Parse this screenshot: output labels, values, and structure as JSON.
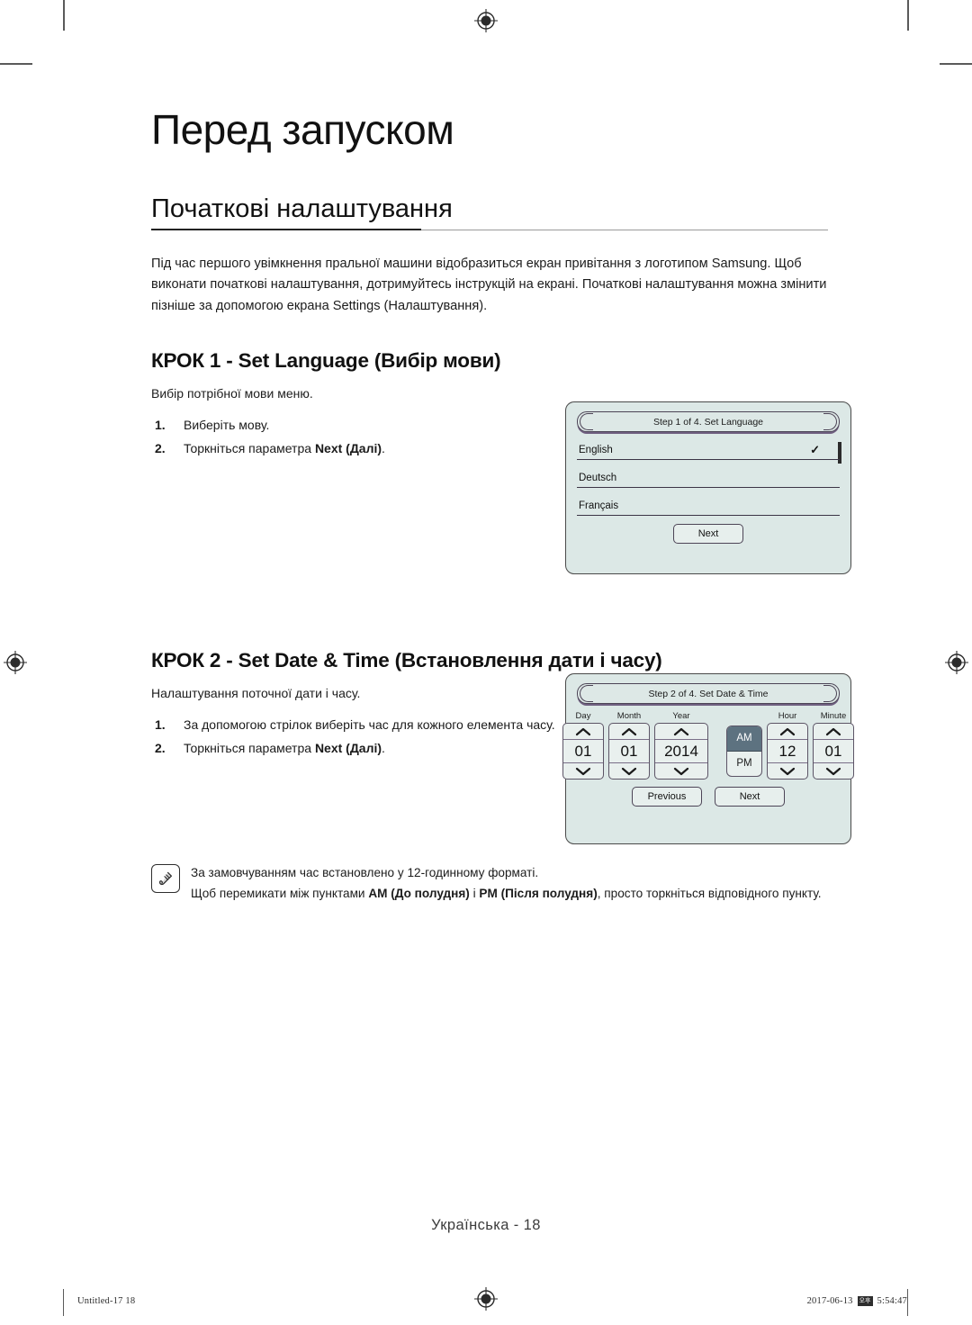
{
  "document": {
    "chapter_title": "Перед запуском",
    "section_title": "Початкові налаштування",
    "intro_paragraph": "Під час першого увімкнення пральної машини відобразиться екран привітання з логотипом Samsung. Щоб виконати початкові налаштування, дотримуйтесь інструкцій на екрані. Початкові налаштування можна змінити пізніше за допомогою екрана Settings (Налаштування)."
  },
  "step1": {
    "title": "КРОК 1 - Set Language (Вибір мови)",
    "lead": "Вибір потрібної мови меню.",
    "items": [
      {
        "num": "1.",
        "text": "Виберіть мову."
      },
      {
        "num": "2.",
        "text_prefix": "Торкніться параметра ",
        "text_bold": "Next (Далі)",
        "text_suffix": "."
      }
    ]
  },
  "step2": {
    "title": "КРОК 2 - Set Date & Time (Встановлення дати і часу)",
    "lead": "Налаштування поточної дати і часу.",
    "items": [
      {
        "num": "1.",
        "text": "За допомогою стрілок виберіть час для кожного елемента часу."
      },
      {
        "num": "2.",
        "text_prefix": "Торкніться параметра ",
        "text_bold": "Next (Далі)",
        "text_suffix": "."
      }
    ]
  },
  "device_language": {
    "screen_title": "Step 1 of 4. Set Language",
    "options": [
      {
        "label": "English",
        "selected": true,
        "check": "✓"
      },
      {
        "label": "Deutsch",
        "selected": false,
        "check": ""
      },
      {
        "label": "Français",
        "selected": false,
        "check": ""
      }
    ],
    "next_button": "Next"
  },
  "device_datetime": {
    "screen_title": "Step 2 of 4. Set Date & Time",
    "spinners": [
      {
        "caption": "Day",
        "value": "01"
      },
      {
        "caption": "Month",
        "value": "01"
      },
      {
        "caption": "Year",
        "value": "2014"
      }
    ],
    "meridiem": {
      "am": "AM",
      "pm": "PM",
      "selected": "AM"
    },
    "time_spinners": [
      {
        "caption": "Hour",
        "value": "12"
      },
      {
        "caption": "Minute",
        "value": "01"
      }
    ],
    "previous_button": "Previous",
    "next_button": "Next"
  },
  "note": {
    "line1": "За замовчуванням час встановлено у 12-годинному форматі.",
    "line2_prefix": "Щоб перемикати між пунктами ",
    "line2_bold1": "AM (До полудня)",
    "line2_mid": " і ",
    "line2_bold2": "PM (Після полудня)",
    "line2_suffix": ", просто торкніться відповідного пункту."
  },
  "footer": {
    "page_label": "Українська - 18",
    "print_left": "Untitled-17   18",
    "print_date": "2017-06-13",
    "print_glyph": "오후",
    "print_time": "5:54:47"
  },
  "colors": {
    "device_background": "#dce8e6",
    "device_border": "#4a4a4a",
    "accent_purple": "#6f5f80",
    "meridiem_active": "#5d7280",
    "rule": "#222222"
  }
}
